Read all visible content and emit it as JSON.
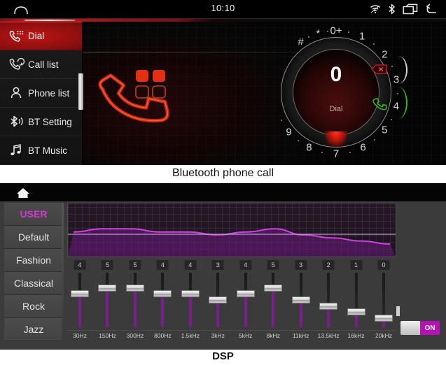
{
  "bluetooth_screen": {
    "caption": "Bluetooth phone call",
    "statusbar": {
      "clock": "10:10",
      "home_icon": "home-icon",
      "wifi_icon": "wifi-icon",
      "bluetooth_icon": "bluetooth-icon",
      "recents_icon": "recent-apps-icon",
      "back_icon": "back-arrow-icon"
    },
    "sidebar": {
      "items": [
        {
          "label": "Dial",
          "icon": "phone-keypad-icon",
          "active": true
        },
        {
          "label": "Call list",
          "icon": "call-history-icon",
          "active": false
        },
        {
          "label": "Phone list",
          "icon": "contact-person-icon",
          "active": false
        },
        {
          "label": "BT Setting",
          "icon": "bluetooth-icon",
          "active": false
        },
        {
          "label": "BT Music",
          "icon": "music-note-icon",
          "active": false
        }
      ]
    },
    "dialer": {
      "display_number": "0",
      "display_caption": "Dial",
      "keys": [
        "1",
        "2",
        "3",
        "4",
        "5",
        "6",
        "7",
        "8",
        "9",
        "0+",
        "*",
        "#"
      ],
      "delete_button": "delete-backspace-button",
      "call_button": "call-answer-button",
      "accent_color": "#c01414",
      "call_color": "#35b820"
    }
  },
  "dsp_screen": {
    "caption": "DSP",
    "home_icon": "home-icon",
    "presets": [
      {
        "label": "USER",
        "active": true
      },
      {
        "label": "Default",
        "active": false
      },
      {
        "label": "Fashion",
        "active": false
      },
      {
        "label": "Classical",
        "active": false
      },
      {
        "label": "Rock",
        "active": false
      },
      {
        "label": "Jazz",
        "active": false
      }
    ],
    "active_preset_color": "#d437d4",
    "power_toggle": {
      "state_label": "ON",
      "on": true,
      "on_color": "#b313b3"
    },
    "chart_data": {
      "type": "bar",
      "title": "",
      "subtitle": "",
      "xlabel": "",
      "ylabel": "",
      "categories": [
        "30Hz",
        "150Hz",
        "300Hz",
        "800Hz",
        "1.5kHz",
        "3kHz",
        "5kHz",
        "8kHz",
        "11kHz",
        "13.5kHz",
        "16kHz",
        "20kHz"
      ],
      "values": [
        4,
        5,
        5,
        4,
        4,
        3,
        4,
        5,
        3,
        2,
        1,
        0
      ],
      "ylim": [
        0,
        6
      ],
      "grid": true,
      "legend": "none",
      "curve_label": "eq-response-curve",
      "curve_color": "#d040e0",
      "fill_color": "#6b1a80"
    }
  }
}
